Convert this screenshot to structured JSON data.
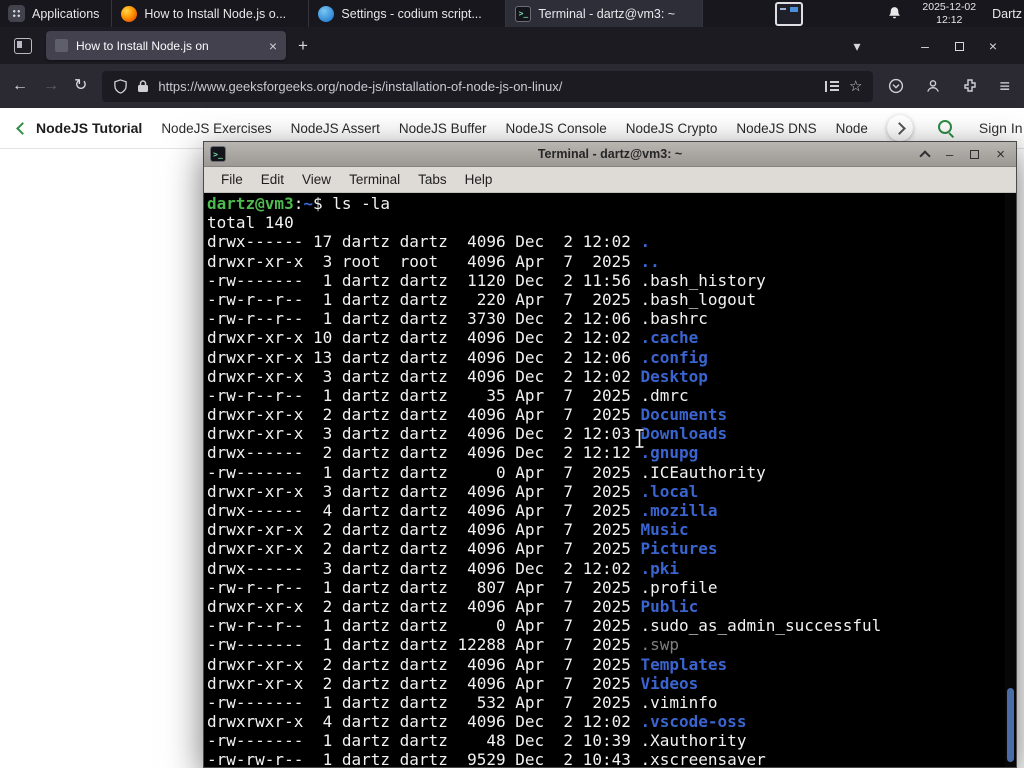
{
  "colors": {
    "accent_green": "#2f8d46",
    "dir_blue": "#3a64cf",
    "prompt_green": "#4fba4f",
    "dim_gray": "#808080",
    "terminal_fg": "#f2f2f2"
  },
  "glyphs": {
    "back": "←",
    "forward": "→",
    "reload": "↻",
    "new_tab": "+",
    "tab_close": "×",
    "list_tabs": "▾",
    "minimize": "–",
    "close": "×",
    "menu": "≡",
    "star": "☆",
    "terminal_prompt_icon": ">_"
  },
  "system_bar": {
    "applications_label": "Applications",
    "taskbar": [
      {
        "icon": "firefox",
        "title": "How to Install Node.js o...",
        "active": false
      },
      {
        "icon": "settings",
        "title": "Settings - codium script...",
        "active": false
      },
      {
        "icon": "terminal",
        "title": "Terminal - dartz@vm3: ~",
        "active": true
      }
    ],
    "clock": {
      "date": "2025-12-02",
      "time": "12:12"
    },
    "user": "Dartz"
  },
  "browser": {
    "tab": {
      "title": "How to Install Node.js on"
    },
    "toolbar": {
      "url": "https://www.geeksforgeeks.org/node-js/installation-of-node-js-on-linux/"
    },
    "site_nav": {
      "links": [
        "NodeJS Tutorial",
        "NodeJS Exercises",
        "NodeJS Assert",
        "NodeJS Buffer",
        "NodeJS Console",
        "NodeJS Crypto",
        "NodeJS DNS",
        "Node"
      ],
      "sign_in": "Sign In"
    }
  },
  "terminal": {
    "title": "Terminal - dartz@vm3: ~",
    "menu": [
      "File",
      "Edit",
      "View",
      "Terminal",
      "Tabs",
      "Help"
    ],
    "prompt": {
      "user_host": "dartz@vm3",
      "separator": ":",
      "path": "~",
      "symbol": "$",
      "command": "ls -la"
    },
    "total": "total 140",
    "listing": [
      {
        "perms": "drwx------",
        "links": "17",
        "owner": "dartz",
        "group": "dartz",
        "size": "4096",
        "month": "Dec",
        "day": "2",
        "date": "12:02",
        "name": ".",
        "type": "dir"
      },
      {
        "perms": "drwxr-xr-x",
        "links": "3",
        "owner": "root",
        "group": "root",
        "size": "4096",
        "month": "Apr",
        "day": "7",
        "date": "2025",
        "name": "..",
        "type": "dir"
      },
      {
        "perms": "-rw-------",
        "links": "1",
        "owner": "dartz",
        "group": "dartz",
        "size": "1120",
        "month": "Dec",
        "day": "2",
        "date": "11:56",
        "name": ".bash_history",
        "type": "file"
      },
      {
        "perms": "-rw-r--r--",
        "links": "1",
        "owner": "dartz",
        "group": "dartz",
        "size": "220",
        "month": "Apr",
        "day": "7",
        "date": "2025",
        "name": ".bash_logout",
        "type": "file"
      },
      {
        "perms": "-rw-r--r--",
        "links": "1",
        "owner": "dartz",
        "group": "dartz",
        "size": "3730",
        "month": "Dec",
        "day": "2",
        "date": "12:06",
        "name": ".bashrc",
        "type": "file"
      },
      {
        "perms": "drwxr-xr-x",
        "links": "10",
        "owner": "dartz",
        "group": "dartz",
        "size": "4096",
        "month": "Dec",
        "day": "2",
        "date": "12:02",
        "name": ".cache",
        "type": "dir"
      },
      {
        "perms": "drwxr-xr-x",
        "links": "13",
        "owner": "dartz",
        "group": "dartz",
        "size": "4096",
        "month": "Dec",
        "day": "2",
        "date": "12:06",
        "name": ".config",
        "type": "dir"
      },
      {
        "perms": "drwxr-xr-x",
        "links": "3",
        "owner": "dartz",
        "group": "dartz",
        "size": "4096",
        "month": "Dec",
        "day": "2",
        "date": "12:02",
        "name": "Desktop",
        "type": "dir"
      },
      {
        "perms": "-rw-r--r--",
        "links": "1",
        "owner": "dartz",
        "group": "dartz",
        "size": "35",
        "month": "Apr",
        "day": "7",
        "date": "2025",
        "name": ".dmrc",
        "type": "file"
      },
      {
        "perms": "drwxr-xr-x",
        "links": "2",
        "owner": "dartz",
        "group": "dartz",
        "size": "4096",
        "month": "Apr",
        "day": "7",
        "date": "2025",
        "name": "Documents",
        "type": "dir"
      },
      {
        "perms": "drwxr-xr-x",
        "links": "3",
        "owner": "dartz",
        "group": "dartz",
        "size": "4096",
        "month": "Dec",
        "day": "2",
        "date": "12:03",
        "name": "Downloads",
        "type": "dir"
      },
      {
        "perms": "drwx------",
        "links": "2",
        "owner": "dartz",
        "group": "dartz",
        "size": "4096",
        "month": "Dec",
        "day": "2",
        "date": "12:12",
        "name": ".gnupg",
        "type": "dir"
      },
      {
        "perms": "-rw-------",
        "links": "1",
        "owner": "dartz",
        "group": "dartz",
        "size": "0",
        "month": "Apr",
        "day": "7",
        "date": "2025",
        "name": ".ICEauthority",
        "type": "file"
      },
      {
        "perms": "drwxr-xr-x",
        "links": "3",
        "owner": "dartz",
        "group": "dartz",
        "size": "4096",
        "month": "Apr",
        "day": "7",
        "date": "2025",
        "name": ".local",
        "type": "dir"
      },
      {
        "perms": "drwx------",
        "links": "4",
        "owner": "dartz",
        "group": "dartz",
        "size": "4096",
        "month": "Apr",
        "day": "7",
        "date": "2025",
        "name": ".mozilla",
        "type": "dir"
      },
      {
        "perms": "drwxr-xr-x",
        "links": "2",
        "owner": "dartz",
        "group": "dartz",
        "size": "4096",
        "month": "Apr",
        "day": "7",
        "date": "2025",
        "name": "Music",
        "type": "dir"
      },
      {
        "perms": "drwxr-xr-x",
        "links": "2",
        "owner": "dartz",
        "group": "dartz",
        "size": "4096",
        "month": "Apr",
        "day": "7",
        "date": "2025",
        "name": "Pictures",
        "type": "dir"
      },
      {
        "perms": "drwx------",
        "links": "3",
        "owner": "dartz",
        "group": "dartz",
        "size": "4096",
        "month": "Dec",
        "day": "2",
        "date": "12:02",
        "name": ".pki",
        "type": "dir"
      },
      {
        "perms": "-rw-r--r--",
        "links": "1",
        "owner": "dartz",
        "group": "dartz",
        "size": "807",
        "month": "Apr",
        "day": "7",
        "date": "2025",
        "name": ".profile",
        "type": "file"
      },
      {
        "perms": "drwxr-xr-x",
        "links": "2",
        "owner": "dartz",
        "group": "dartz",
        "size": "4096",
        "month": "Apr",
        "day": "7",
        "date": "2025",
        "name": "Public",
        "type": "dir"
      },
      {
        "perms": "-rw-r--r--",
        "links": "1",
        "owner": "dartz",
        "group": "dartz",
        "size": "0",
        "month": "Apr",
        "day": "7",
        "date": "2025",
        "name": ".sudo_as_admin_successful",
        "type": "file"
      },
      {
        "perms": "-rw-------",
        "links": "1",
        "owner": "dartz",
        "group": "dartz",
        "size": "12288",
        "month": "Apr",
        "day": "7",
        "date": "2025",
        "name": ".swp",
        "type": "dim"
      },
      {
        "perms": "drwxr-xr-x",
        "links": "2",
        "owner": "dartz",
        "group": "dartz",
        "size": "4096",
        "month": "Apr",
        "day": "7",
        "date": "2025",
        "name": "Templates",
        "type": "dir"
      },
      {
        "perms": "drwxr-xr-x",
        "links": "2",
        "owner": "dartz",
        "group": "dartz",
        "size": "4096",
        "month": "Apr",
        "day": "7",
        "date": "2025",
        "name": "Videos",
        "type": "dir"
      },
      {
        "perms": "-rw-------",
        "links": "1",
        "owner": "dartz",
        "group": "dartz",
        "size": "532",
        "month": "Apr",
        "day": "7",
        "date": "2025",
        "name": ".viminfo",
        "type": "file"
      },
      {
        "perms": "drwxrwxr-x",
        "links": "4",
        "owner": "dartz",
        "group": "dartz",
        "size": "4096",
        "month": "Dec",
        "day": "2",
        "date": "12:02",
        "name": ".vscode-oss",
        "type": "dir"
      },
      {
        "perms": "-rw-------",
        "links": "1",
        "owner": "dartz",
        "group": "dartz",
        "size": "48",
        "month": "Dec",
        "day": "2",
        "date": "10:39",
        "name": ".Xauthority",
        "type": "file"
      },
      {
        "perms": "-rw-rw-r--",
        "links": "1",
        "owner": "dartz",
        "group": "dartz",
        "size": "9529",
        "month": "Dec",
        "day": "2",
        "date": "10:43",
        "name": ".xscreensaver",
        "type": "file"
      }
    ]
  }
}
